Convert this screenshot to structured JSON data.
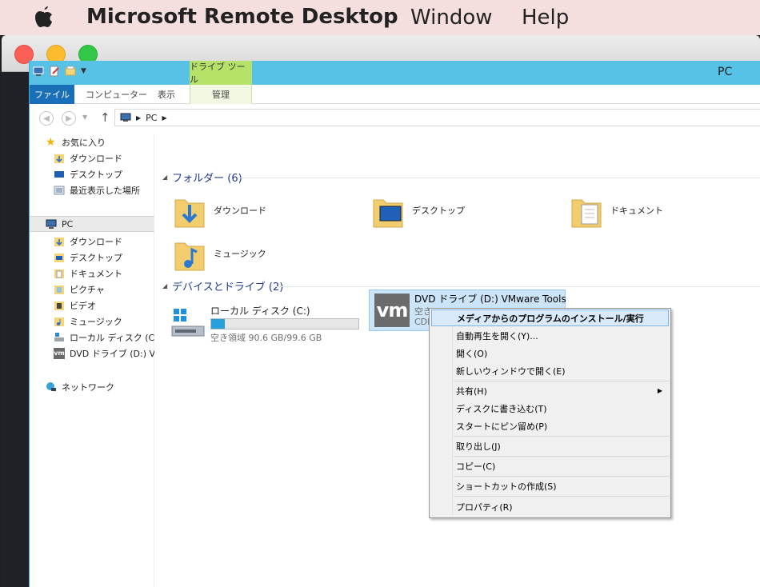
{
  "menubar": {
    "app_name": "Microsoft Remote Desktop",
    "items": [
      "Window",
      "Help"
    ]
  },
  "explorer": {
    "window_title": "PC",
    "context_tab_header": "ドライブ ツール",
    "ribbon_tabs": [
      "ファイル",
      "コンピューター",
      "表示",
      "管理"
    ],
    "address": {
      "location": "PC"
    },
    "nav": {
      "favorites_label": "お気に入り",
      "favorites": [
        "ダウンロード",
        "デスクトップ",
        "最近表示した場所"
      ],
      "pc_label": "PC",
      "pc_items": [
        "ダウンロード",
        "デスクトップ",
        "ドキュメント",
        "ピクチャ",
        "ビデオ",
        "ミュージック",
        "ローカル ディスク (C:)",
        "DVD ドライブ (D:) VI"
      ],
      "network_label": "ネットワーク"
    },
    "folders_header": "フォルダー (6)",
    "folders": [
      "ダウンロード",
      "デスクトップ",
      "ドキュメント",
      "ミュージック"
    ],
    "devices_header": "デバイスとドライブ (2)",
    "local_disk": {
      "name": "ローカル ディスク (C:)",
      "usage_fraction": 0.09,
      "info": "空き領域 90.6 GB/99.6 GB"
    },
    "dvd": {
      "logo": "vm",
      "name": "DVD ドライブ (D:) VMware Tools",
      "free": "空き",
      "fs": "CDF"
    }
  },
  "context_menu": {
    "items": [
      "メディアからのプログラムのインストール/実行",
      "自動再生を開く(Y)...",
      "開く(O)",
      "新しいウィンドウで開く(E)",
      "共有(H)",
      "ディスクに書き込む(T)",
      "スタートにピン留め(P)",
      "取り出し(J)",
      "コピー(C)",
      "ショートカットの作成(S)",
      "プロパティ(R)"
    ]
  },
  "colors": {
    "menubar_bg": "#f5dede",
    "explorer_title_bg": "#58c2e6",
    "file_tab": "#1a6fb9",
    "drive_tools_tab": "#b7e26a",
    "group_header": "#1e3a8c",
    "selection": "#cce4f7"
  }
}
